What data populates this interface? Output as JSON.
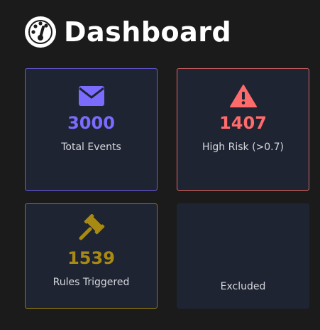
{
  "header": {
    "title": "Dashboard",
    "icon": "speedometer-icon"
  },
  "cards": {
    "total_events": {
      "icon": "envelope-icon",
      "value": "3000",
      "label": "Total Events",
      "color": "#7b6cff"
    },
    "high_risk": {
      "icon": "warning-triangle-icon",
      "value": "1407",
      "label": "High Risk (>0.7)",
      "color": "#ff6b6b"
    },
    "rules_triggered": {
      "icon": "gavel-icon",
      "value": "1539",
      "label": "Rules Triggered",
      "color": "#a88a12"
    },
    "excluded": {
      "label": "Excluded"
    }
  }
}
